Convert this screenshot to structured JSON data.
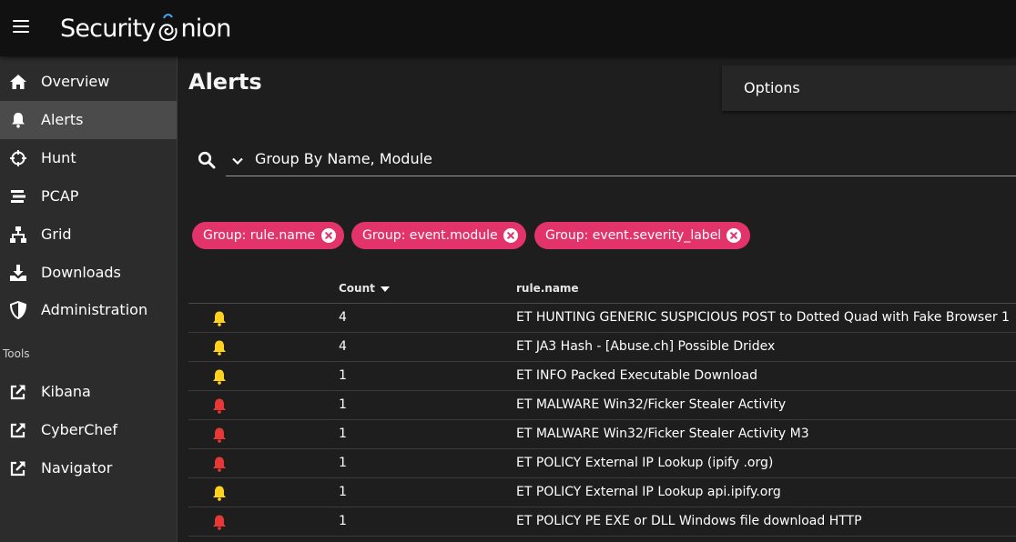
{
  "app": {
    "brand": "Security Onion",
    "brand_left": "Security",
    "brand_right": "nion"
  },
  "sidebar": {
    "items": [
      {
        "label": "Overview",
        "icon": "home-icon"
      },
      {
        "label": "Alerts",
        "icon": "bell-icon",
        "active": true
      },
      {
        "label": "Hunt",
        "icon": "crosshairs-icon"
      },
      {
        "label": "PCAP",
        "icon": "stream-icon"
      },
      {
        "label": "Grid",
        "icon": "sitemap-icon"
      },
      {
        "label": "Downloads",
        "icon": "download-icon"
      },
      {
        "label": "Administration",
        "icon": "shield-icon"
      }
    ],
    "tools_header": "Tools",
    "tools": [
      {
        "label": "Kibana",
        "icon": "external-link-icon"
      },
      {
        "label": "CyberChef",
        "icon": "external-link-icon"
      },
      {
        "label": "Navigator",
        "icon": "external-link-icon"
      }
    ]
  },
  "main": {
    "title": "Alerts",
    "options_label": "Options",
    "query": "Group By Name, Module",
    "chips": [
      {
        "label": "Group: rule.name"
      },
      {
        "label": "Group: event.module"
      },
      {
        "label": "Group: event.severity_label"
      }
    ],
    "table": {
      "columns": {
        "count": "Count",
        "rule": "rule.name"
      },
      "rows": [
        {
          "severity": "medium",
          "count": "4",
          "rule": "ET HUNTING GENERIC SUSPICIOUS POST to Dotted Quad with Fake Browser 1"
        },
        {
          "severity": "medium",
          "count": "4",
          "rule": "ET JA3 Hash - [Abuse.ch] Possible Dridex"
        },
        {
          "severity": "medium",
          "count": "1",
          "rule": "ET INFO Packed Executable Download"
        },
        {
          "severity": "high",
          "count": "1",
          "rule": "ET MALWARE Win32/Ficker Stealer Activity"
        },
        {
          "severity": "high",
          "count": "1",
          "rule": "ET MALWARE Win32/Ficker Stealer Activity M3"
        },
        {
          "severity": "high",
          "count": "1",
          "rule": "ET POLICY External IP Lookup (ipify .org)"
        },
        {
          "severity": "medium",
          "count": "1",
          "rule": "ET POLICY External IP Lookup api.ipify.org"
        },
        {
          "severity": "high",
          "count": "1",
          "rule": "ET POLICY PE EXE or DLL Windows file download HTTP"
        }
      ]
    }
  },
  "colors": {
    "chip": "#e3336b",
    "severity_medium": "#ffd21f",
    "severity_high": "#e53935"
  }
}
